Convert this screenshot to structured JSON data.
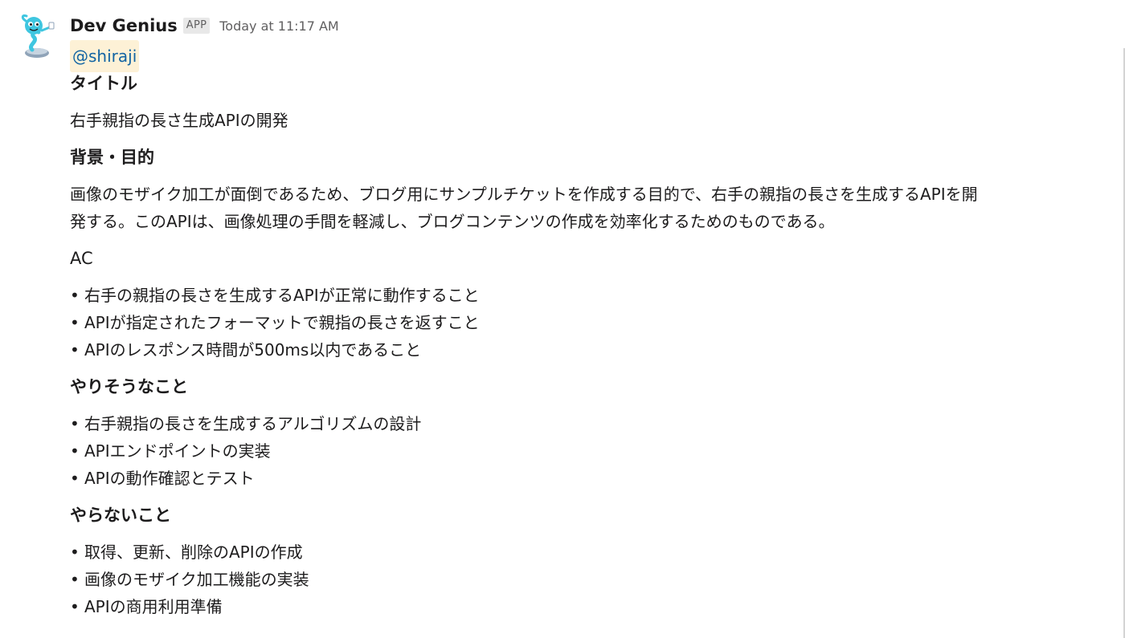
{
  "message": {
    "sender": "Dev Genius",
    "app_badge": "APP",
    "timestamp": "Today at 11:17 AM",
    "mention": "@shiraji",
    "sections": [
      {
        "title": "タイトル",
        "paragraph": "右手親指の長さ生成APIの開発"
      },
      {
        "title": "背景・目的",
        "paragraph_line1": "画像のモザイク加工が面倒であるため、ブログ用にサンプルチケットを作成する目的で、右手の親指の長さを生成するAPIを開",
        "paragraph_line2": "発する。このAPIは、画像処理の手間を軽減し、ブログコンテンツの作成を効率化するためのものである。"
      },
      {
        "title": "AC",
        "items": [
          "右手の親指の長さを生成するAPIが正常に動作すること",
          "APIが指定されたフォーマットで親指の長さを返すこと",
          "APIのレスポンス時間が500ms以内であること"
        ]
      },
      {
        "title": "やりそうなこと",
        "items": [
          "右手親指の長さを生成するアルゴリズムの設計",
          "APIエンドポイントの実装",
          "APIの動作確認とテスト"
        ]
      },
      {
        "title": "やらないこと",
        "items": [
          "取得、更新、削除のAPIの作成",
          "画像のモザイク加工機能の実装",
          "APIの商用利用準備"
        ]
      }
    ],
    "bullet_glyph": "•"
  },
  "colors": {
    "text": "#1d1c1d",
    "muted": "#616061",
    "mention_bg": "#fdf1d6",
    "mention_text": "#1264a3",
    "avatar_primary": "#3fc6e0"
  },
  "icons": {
    "avatar": "genie-bot-avatar-icon"
  }
}
